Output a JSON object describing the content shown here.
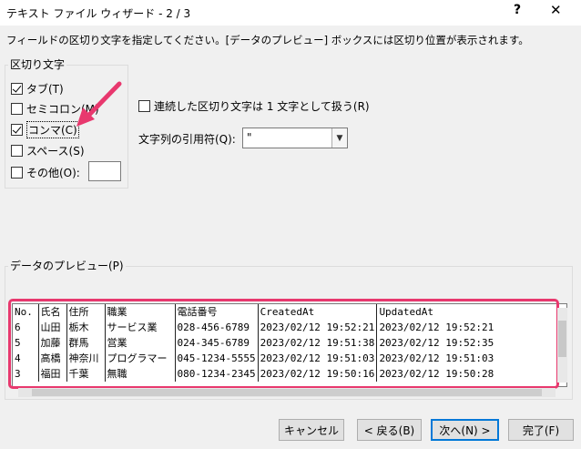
{
  "window": {
    "title": "テキスト ファイル ウィザード - 2 / 3",
    "help": "?",
    "close": "✕"
  },
  "instruction": "フィールドの区切り文字を指定してください。[データのプレビュー] ボックスには区切り位置が表示されます。",
  "delimiters": {
    "group_label": "区切り文字",
    "items": [
      {
        "label": "タブ(T)",
        "checked": true
      },
      {
        "label": "セミコロン(M)",
        "checked": false
      },
      {
        "label": "コンマ(C)",
        "checked": true
      },
      {
        "label": "スペース(S)",
        "checked": false
      },
      {
        "label": "その他(O):",
        "checked": false
      }
    ],
    "other_value": ""
  },
  "options": {
    "consecutive_label": "連続した区切り文字は 1 文字として扱う(R)",
    "consecutive_checked": false,
    "text_qualifier_label": "文字列の引用符(Q):",
    "text_qualifier_value": "\""
  },
  "preview": {
    "label": "データのプレビュー(P)",
    "headers": [
      "No.",
      "氏名",
      "住所",
      "職業",
      "電話番号",
      "CreatedAt",
      "UpdatedAt"
    ],
    "rows": [
      [
        "6",
        "山田",
        "栃木",
        "サービス業",
        "028-456-6789",
        " 2023/02/12 19:52:21",
        " 2023/02/12 19:52:21"
      ],
      [
        "5",
        "加藤",
        "群馬",
        "営業",
        "024-345-6789",
        " 2023/02/12 19:51:38",
        " 2023/02/12 19:52:35"
      ],
      [
        "4",
        "高橋",
        "神奈川",
        "プログラマー",
        "045-1234-5555",
        " 2023/02/12 19:51:03",
        " 2023/02/12 19:51:03"
      ],
      [
        "3",
        "福田",
        "千葉",
        "無職",
        "080-1234-2345",
        " 2023/02/12 19:50:16",
        " 2023/02/12 19:50:28"
      ]
    ]
  },
  "buttons": {
    "cancel": "キャンセル",
    "back": "< 戻る(B)",
    "next": "次へ(N) >",
    "finish": "完了(F)"
  },
  "colors": {
    "highlight": "#e8386e",
    "accent": "#0078d7"
  }
}
